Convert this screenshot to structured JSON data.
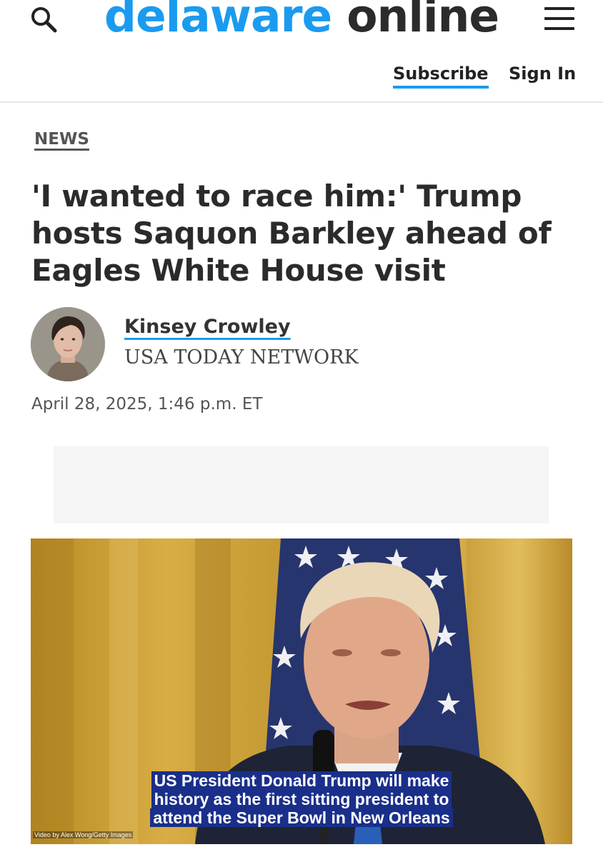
{
  "site": {
    "logo_part1": "delaware",
    "logo_part2": "online"
  },
  "header": {
    "subscribe_label": "Subscribe",
    "signin_label": "Sign In"
  },
  "article": {
    "label": "NEWS",
    "headline": "'I wanted to race him:' Trump hosts Saquon Barkley ahead of Eagles White House visit",
    "author": {
      "name": "Kinsey Crowley",
      "org": "USA TODAY NETWORK"
    },
    "date": "April 28, 2025, 1:46 p.m. ET"
  },
  "video": {
    "caption_lines": [
      "US President Donald Trump will make",
      "history as the first sitting president to",
      "attend the Super Bowl in New Orleans"
    ],
    "credit": "Video by Alex Wong/Getty Images"
  },
  "icons": {
    "search": "search-icon",
    "menu": "hamburger-menu-icon"
  },
  "colors": {
    "brand_blue": "#1a9bf0",
    "caption_bg": "#1a2f8a"
  }
}
